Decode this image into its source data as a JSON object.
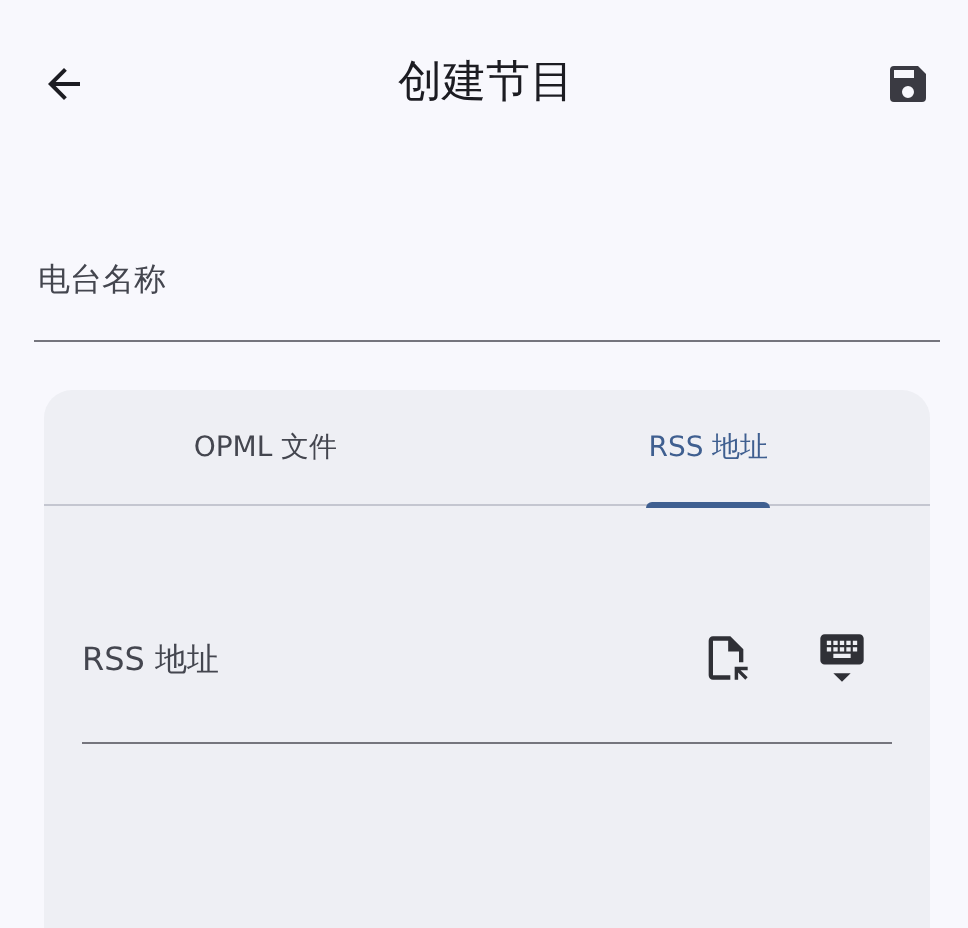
{
  "app_bar": {
    "title": "创建节目"
  },
  "name_field": {
    "placeholder": "电台名称"
  },
  "tabs": [
    {
      "label": "OPML 文件",
      "selected": false
    },
    {
      "label": "RSS 地址",
      "selected": true
    }
  ],
  "rss_field": {
    "placeholder": "RSS 地址"
  }
}
